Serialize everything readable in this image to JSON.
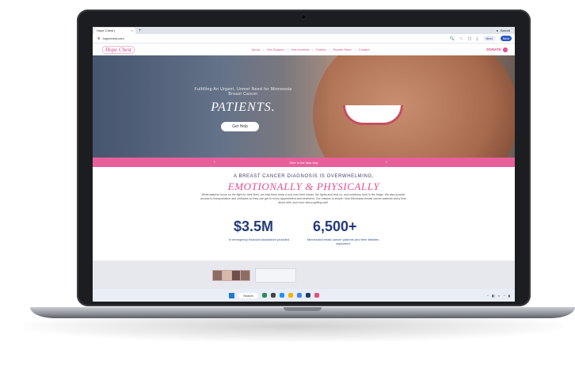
{
  "browser": {
    "tab_title": "Hope Chest | ",
    "new_tab": "+",
    "url": "hopechest.com",
    "account_label": "Barratt",
    "pill_label": "Next",
    "pill_blue": "Next"
  },
  "site": {
    "logo": "Hope Chest",
    "nav": [
      "About",
      "Get Support",
      "Get Involved",
      "Events",
      "Resale Store",
      "Contact"
    ],
    "donate": "DONATE"
  },
  "hero": {
    "subtitle": "Fulfilling An Urgent, Unmet Need for Minnesota Breast Cancer",
    "title": "PATIENTS.",
    "button": "Get Help"
  },
  "banner": {
    "text": "Give to the Max Day",
    "left": "‹",
    "right": "›"
  },
  "content": {
    "caps": "A BREAST CANCER DIAGNOSIS IS OVERWHELMING,",
    "emphasis": "EMOTIONALLY & PHYSICALLY",
    "paragraph": "While patients focus on the fight for their lives, we help them keep a roof over their heads, the lights and heat on, and nutritious food in the fridge. We also provide access to transportation and childcare so they can get to every appointment and treatment. Our mission is simple: help Minnesota breast cancer patients worry less about bills, and more about getting well.",
    "stats": [
      {
        "value": "$3.5M",
        "label": "in emergency financial assistance provided"
      },
      {
        "value": "6,500+",
        "label": "Minnesota breast cancer patients and their families supported"
      }
    ]
  },
  "taskbar": {
    "search": "Search"
  },
  "colors": {
    "brand_pink": "#e85f9c",
    "navy": "#243b7a"
  }
}
